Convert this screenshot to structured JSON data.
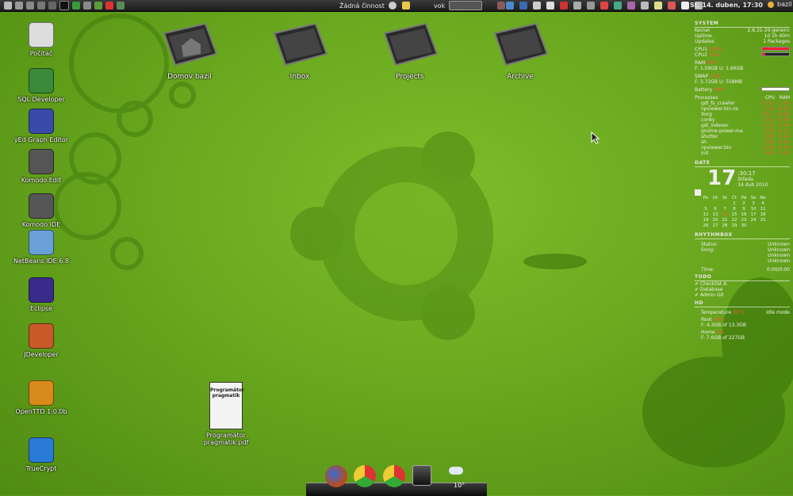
{
  "top_panel": {
    "activity": "Žádná činnost",
    "window_label": "vok",
    "clock": "St, 14. duben, 17:30",
    "user": "bazil"
  },
  "desktop_icons": [
    {
      "label": "Počítač",
      "icon": "computer-icon"
    },
    {
      "label": "SQL Developer",
      "icon": "sql-developer-icon"
    },
    {
      "label": "yEd Graph Editor",
      "icon": "yed-icon"
    },
    {
      "label": "Komodo Edit",
      "icon": "komodo-edit-icon"
    },
    {
      "label": "Komodo IDE",
      "icon": "komodo-ide-icon"
    },
    {
      "label": "NetBeans IDE 6.8",
      "icon": "netbeans-icon"
    },
    {
      "label": "Eclipse",
      "icon": "eclipse-icon"
    },
    {
      "label": "JDeveloper",
      "icon": "jdeveloper-icon"
    },
    {
      "label": "OpenTTD 1.0.0b",
      "icon": "openttd-icon"
    },
    {
      "label": "TrueCrypt",
      "icon": "truecrypt-icon"
    }
  ],
  "folders": [
    {
      "label": "Domov bazil"
    },
    {
      "label": "Inbox"
    },
    {
      "label": "Projects"
    },
    {
      "label": "Archive"
    }
  ],
  "pdf_file": {
    "label_line1": "Programátor",
    "label_line2": "pragmatik.pdf",
    "cover_title": "Programátor pragmatik"
  },
  "conky": {
    "system": {
      "header": "SYSTEM",
      "kernel_label": "Kernel",
      "kernel": "2.6.31-20-generic",
      "uptime_label": "Uptime",
      "uptime": "1d 1h 40m",
      "updates_label": "Updates",
      "updates": "1 Packages",
      "cpu1_label": "CPU1",
      "cpu1": "100%",
      "cpu2_label": "CPU2",
      "cpu2": "12%",
      "ram_label": "RAM",
      "ram_pct": "62%",
      "ram_detail": "F: 1.09GB  U: 1.66GB",
      "swap_label": "SWAP",
      "swap_pct": "14%",
      "swap_detail": "F: 3.72GB  U: 558MB",
      "battery_label": "Battery",
      "battery": "84%",
      "proc_label": "Processes",
      "proc_cpu": "CPU",
      "proc_ram": "RAM",
      "processes": [
        {
          "name": "gdl_fs_crawler",
          "cpu": "51.52",
          "ram": "2.53"
        },
        {
          "name": "npviewer.bin.ns",
          "cpu": "2.02",
          "ram": "8.63"
        },
        {
          "name": "Xorg",
          "cpu": "1.01",
          "ram": "12.45"
        },
        {
          "name": "conky",
          "cpu": "0.51",
          "ram": "0.09"
        },
        {
          "name": "gdl_indexer",
          "cpu": "0.51",
          "ram": "0.34"
        },
        {
          "name": "gnome-power-ma",
          "cpu": "0.51",
          "ram": "0.27"
        },
        {
          "name": "shutter",
          "cpu": "0.00",
          "ram": "2.42"
        },
        {
          "name": "sh",
          "cpu": "0.00",
          "ram": "0.02"
        },
        {
          "name": "npviewer.bin",
          "cpu": "0.00",
          "ram": "0.02"
        },
        {
          "name": "init",
          "cpu": "0.00",
          "ram": "0.05"
        }
      ]
    },
    "date": {
      "header": "DATE",
      "day": "17",
      "time": ":30:17",
      "weekday": "Středa",
      "full": "14 dub 2010",
      "calendar_head": [
        "Po",
        "Út",
        "St",
        "Čt",
        "Pá",
        "So",
        "Ne"
      ],
      "calendar": [
        "",
        "",
        "",
        "1",
        "2",
        "3",
        "4",
        "5",
        "6",
        "7",
        "8",
        "9",
        "10",
        "11",
        "12",
        "13",
        "14",
        "15",
        "16",
        "17",
        "18",
        "19",
        "20",
        "21",
        "22",
        "23",
        "24",
        "25",
        "26",
        "27",
        "28",
        "29",
        "30",
        "",
        ""
      ]
    },
    "rhythmbox": {
      "header": "RHYTHMBOX",
      "status_label": "Status:",
      "status": "Unknown",
      "song_label": "Song:",
      "song": "Unknown",
      "artist": "Unknown",
      "album": "Unknown",
      "time_label": "Time:",
      "time": "0:00/0:00"
    },
    "todo": {
      "header": "TODO",
      "items": [
        "Checklist A",
        "Database",
        "Admin Git"
      ]
    },
    "hd": {
      "header": "HD",
      "temp_label": "Temperature",
      "temp": "32°C",
      "temp_state": "Idle mode",
      "root_label": "Root",
      "root_pct": "38%",
      "root_detail": "F: 4.3GB of 13.3GB",
      "home_label": "Home",
      "home_pct": "3%",
      "home_detail": "F: 7.6GB of 227GB"
    }
  },
  "dock": {
    "weather_temp": "10°",
    "items": [
      "firefox-icon",
      "chromium-icon",
      "chrome-icon",
      "terminal-icon"
    ]
  }
}
